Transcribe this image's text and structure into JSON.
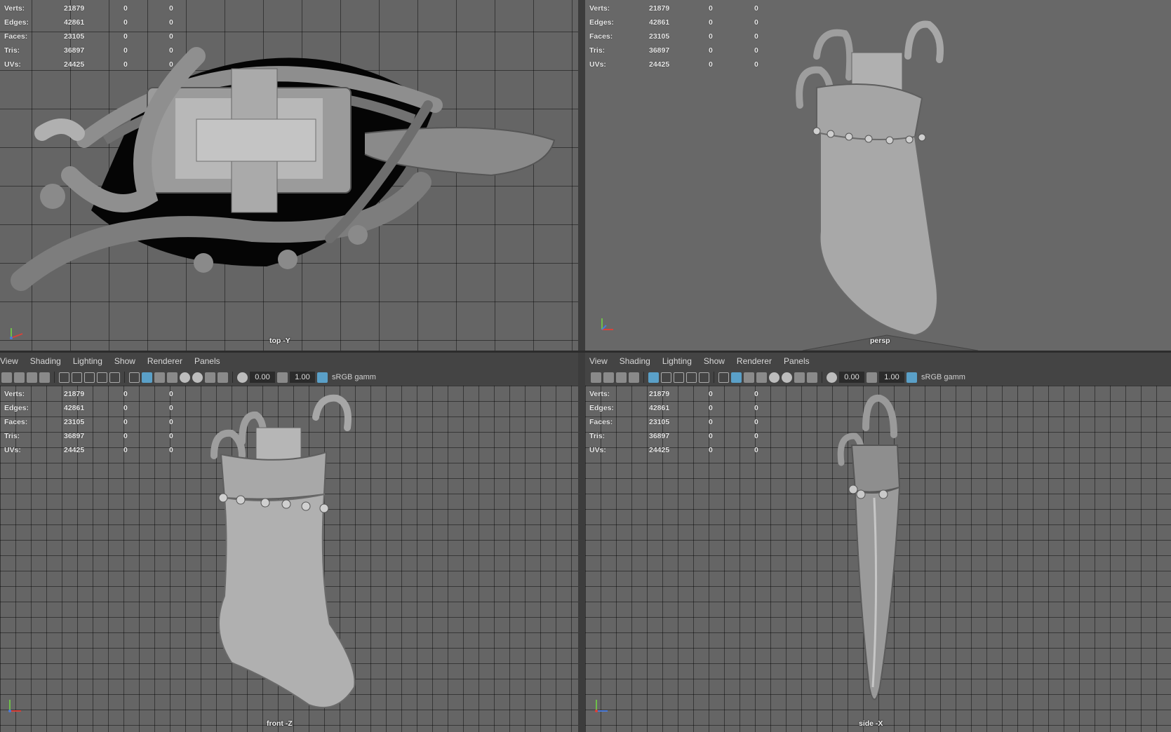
{
  "hud": [
    {
      "label": "Verts:",
      "v1": "21879",
      "v2": "0",
      "v3": "0"
    },
    {
      "label": "Edges:",
      "v1": "42861",
      "v2": "0",
      "v3": "0"
    },
    {
      "label": "Faces:",
      "v1": "23105",
      "v2": "0",
      "v3": "0"
    },
    {
      "label": "Tris:",
      "v1": "36897",
      "v2": "0",
      "v3": "0"
    },
    {
      "label": "UVs:",
      "v1": "24425",
      "v2": "0",
      "v3": "0"
    }
  ],
  "viewports": {
    "top": {
      "camera": "top -Y"
    },
    "persp": {
      "camera": "persp"
    },
    "front": {
      "camera": "front -Z"
    },
    "side": {
      "camera": "side -X"
    }
  },
  "menu": {
    "front": [
      "View",
      "Shading",
      "Lighting",
      "Show",
      "Renderer",
      "Panels"
    ],
    "side": [
      "View",
      "Shading",
      "Lighting",
      "Show",
      "Renderer",
      "Panels"
    ]
  },
  "toolbar": {
    "exposure": "0.00",
    "gamma": "1.00",
    "color_space": "sRGB gamm"
  },
  "colors": {
    "viewport_bg": "#656565",
    "panel_bg": "#444444",
    "accent": "#5aa0c8"
  }
}
